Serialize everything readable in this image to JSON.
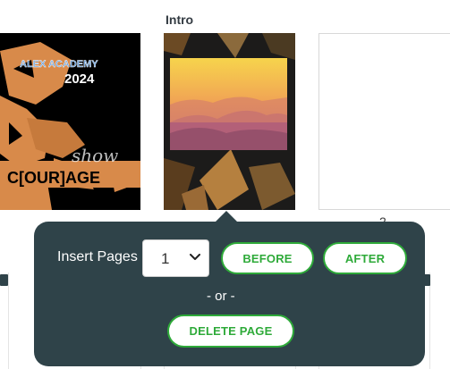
{
  "page_title": "Intro",
  "cover_left": {
    "line1": "ALEX ACADEMY",
    "line2": "2024",
    "script": "show",
    "word": "C[OUR]AGE"
  },
  "blank_page_number": "2",
  "popover": {
    "insert_label": "Insert Pages",
    "count_value": "1",
    "before_label": "BEFORE",
    "after_label": "AFTER",
    "or_label": "- or -",
    "delete_label": "DELETE PAGE"
  },
  "colors": {
    "popover_bg": "#2f4349",
    "accent_green": "#2eaa39",
    "orange": "#d88a4a"
  }
}
